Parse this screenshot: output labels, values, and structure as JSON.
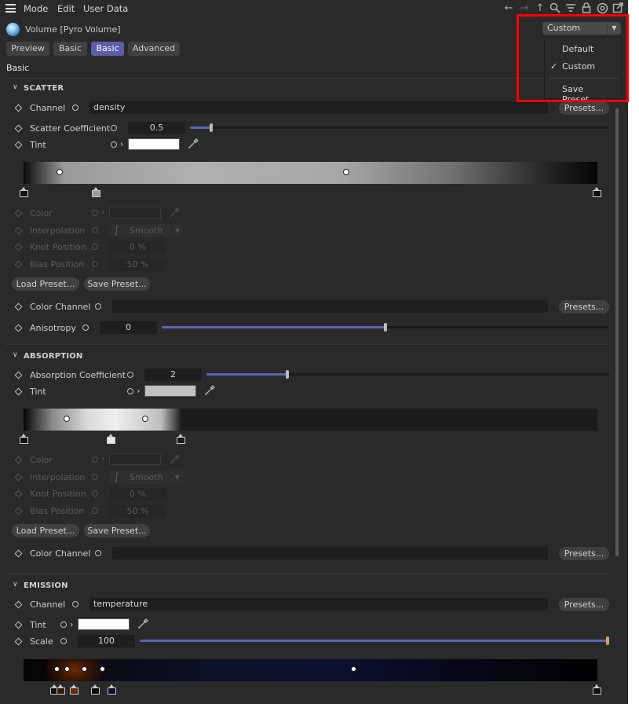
{
  "menu": {
    "mode": "Mode",
    "edit": "Edit",
    "user_data": "User Data"
  },
  "object": {
    "title": "Volume [Pyro Volume]"
  },
  "preset_dropdown": {
    "selected": "Custom",
    "options": [
      {
        "label": "Default",
        "checked": false
      },
      {
        "label": "Custom",
        "checked": true
      },
      {
        "label": "Save Preset...",
        "checked": false
      }
    ]
  },
  "tabs": [
    {
      "label": "Preview",
      "active": false
    },
    {
      "label": "Basic",
      "active": false
    },
    {
      "label": "Basic",
      "active": true
    },
    {
      "label": "Advanced",
      "active": false
    }
  ],
  "section_title": "Basic",
  "scatter": {
    "title": "SCATTER",
    "channel_label": "Channel",
    "channel_value": "density",
    "presets_label": "Presets...",
    "coef_label": "Scatter Coefficient",
    "coef_value": "0.5",
    "coef_slider_fraction": 0.05,
    "tint_label": "Tint",
    "tint_color": "#ffffff",
    "color_label": "Color",
    "interp_label": "Interpolation",
    "interp_value": "Smooth",
    "knot_label": "Knot Position",
    "knot_value": "0 %",
    "bias_label": "Bias Position",
    "bias_value": "50 %",
    "load_preset": "Load Preset...",
    "save_preset": "Save Preset...",
    "color_channel_label": "Color Channel",
    "color_channel_presets": "Presets...",
    "aniso_label": "Anisotropy",
    "aniso_value": "0",
    "aniso_slider_fraction": 0.5
  },
  "absorption": {
    "title": "ABSORPTION",
    "coef_label": "Absorption Coefficient",
    "coef_value": "2",
    "coef_slider_fraction": 0.2,
    "tint_label": "Tint",
    "tint_color": "#c0c0c0",
    "color_label": "Color",
    "interp_label": "Interpolation",
    "interp_value": "Smooth",
    "knot_label": "Knot Position",
    "knot_value": "0 %",
    "bias_label": "Bias Position",
    "bias_value": "50 %",
    "load_preset": "Load Preset...",
    "save_preset": "Save Preset...",
    "color_channel_label": "Color Channel",
    "color_channel_presets": "Presets..."
  },
  "emission": {
    "title": "EMISSION",
    "channel_label": "Channel",
    "channel_value": "temperature",
    "presets_label": "Presets...",
    "tint_label": "Tint",
    "tint_color": "#ffffff",
    "scale_label": "Scale",
    "scale_value": "100",
    "scale_slider_fraction": 1.0
  }
}
